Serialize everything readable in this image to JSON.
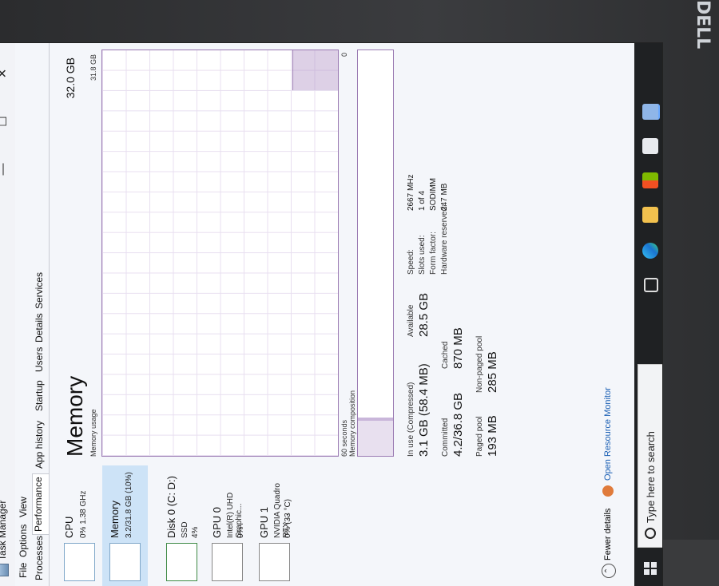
{
  "window": {
    "title": "Task Manager",
    "minimize_glyph": "—",
    "maximize_glyph": "☐",
    "close_glyph": "✕"
  },
  "menu": {
    "file": "File",
    "options": "Options",
    "view": "View"
  },
  "tabs": [
    "Processes",
    "Performance",
    "App history",
    "Startup",
    "Users",
    "Details",
    "Services"
  ],
  "devices": [
    {
      "name": "CPU",
      "sub": "0% 1.38 GHz",
      "selected": false
    },
    {
      "name": "Memory",
      "sub": "3.2/31.8 GB (10%)",
      "selected": true
    },
    {
      "name": "Disk 0 (C: D:)",
      "sub1": "SSD",
      "sub2": "4%"
    },
    {
      "name": "GPU 0",
      "sub1": "Intel(R) UHD Graphic...",
      "sub2": "0%"
    },
    {
      "name": "GPU 1",
      "sub1": "NVIDIA Quadro RTX ...",
      "sub2": "0% (33 °C)"
    }
  ],
  "memory": {
    "title": "Memory",
    "total": "32.0 GB",
    "usage_label": "Memory usage",
    "usage_max": "31.8 GB",
    "time_label": "60 seconds",
    "zero_label": "0",
    "composition_label": "Memory composition",
    "stats": {
      "in_use_label": "In use (Compressed)",
      "in_use_value": "3.1 GB (58.4 MB)",
      "available_label": "Available",
      "available_value": "28.5 GB",
      "committed_label": "Committed",
      "committed_value": "4.2/36.8 GB",
      "cached_label": "Cached",
      "cached_value": "870 MB",
      "paged_label": "Paged pool",
      "paged_value": "193 MB",
      "nonpaged_label": "Non-paged pool",
      "nonpaged_value": "285 MB"
    },
    "specs": {
      "speed_label": "Speed:",
      "speed_value": "2667 MHz",
      "slots_label": "Slots used:",
      "slots_value": "1 of 4",
      "form_label": "Form factor:",
      "form_value": "SODIMM",
      "reserved_label": "Hardware reserved:",
      "reserved_value": "247 MB"
    }
  },
  "footer": {
    "fewer_details": "Fewer details",
    "open_resource_monitor": "Open Resource Monitor"
  },
  "taskbar": {
    "search_placeholder": "Type here to search"
  },
  "colors": {
    "memory_accent": "#9b7bb3",
    "selected_bg": "#cde3f7",
    "taskbar_bg": "#1f2123"
  }
}
